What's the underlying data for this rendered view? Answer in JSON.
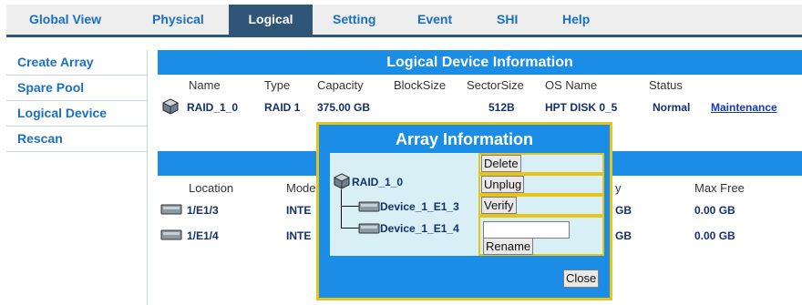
{
  "nav": {
    "tabs": [
      {
        "label": "Global View"
      },
      {
        "label": "Physical"
      },
      {
        "label": "Logical",
        "active": true
      },
      {
        "label": "Setting"
      },
      {
        "label": "Event"
      },
      {
        "label": "SHI"
      },
      {
        "label": "Help"
      }
    ]
  },
  "sidebar": {
    "items": [
      {
        "label": "Create Array"
      },
      {
        "label": "Spare Pool"
      },
      {
        "label": "Logical Device"
      },
      {
        "label": "Rescan"
      }
    ]
  },
  "logical": {
    "title": "Logical Device Information",
    "headers": {
      "name": "Name",
      "type": "Type",
      "capacity": "Capacity",
      "blocksize": "BlockSize",
      "sectorsize": "SectorSize",
      "osname": "OS Name",
      "status": "Status"
    },
    "row": {
      "name": "RAID_1_0",
      "type": "RAID 1",
      "capacity": "375.00 GB",
      "sectorsize": "512B",
      "osname": "HPT DISK 0_5",
      "status": "Normal",
      "action": "Maintenance"
    }
  },
  "physical": {
    "headers": {
      "location": "Location",
      "model": "Mode",
      "capacity_tail": "y",
      "maxfree": "Max Free"
    },
    "rows": [
      {
        "location": "1/E1/3",
        "model": "INTE",
        "capacity_tail": "GB",
        "maxfree": "0.00 GB"
      },
      {
        "location": "1/E1/4",
        "model": "INTE",
        "capacity_tail": "GB",
        "maxfree": "0.00 GB"
      }
    ]
  },
  "modal": {
    "title": "Array Information",
    "tree": {
      "root": "RAID_1_0",
      "children": [
        "Device_1_E1_3",
        "Device_1_E1_4"
      ]
    },
    "buttons": {
      "delete": "Delete",
      "unplug": "Unplug",
      "verify": "Verify",
      "rename": "Rename",
      "close": "Close"
    },
    "rename_value": ""
  },
  "colors": {
    "banner": "#1c8de6",
    "nav_active": "#2f5677",
    "link": "#1a6fc0",
    "modal_border": "#e6c419"
  }
}
